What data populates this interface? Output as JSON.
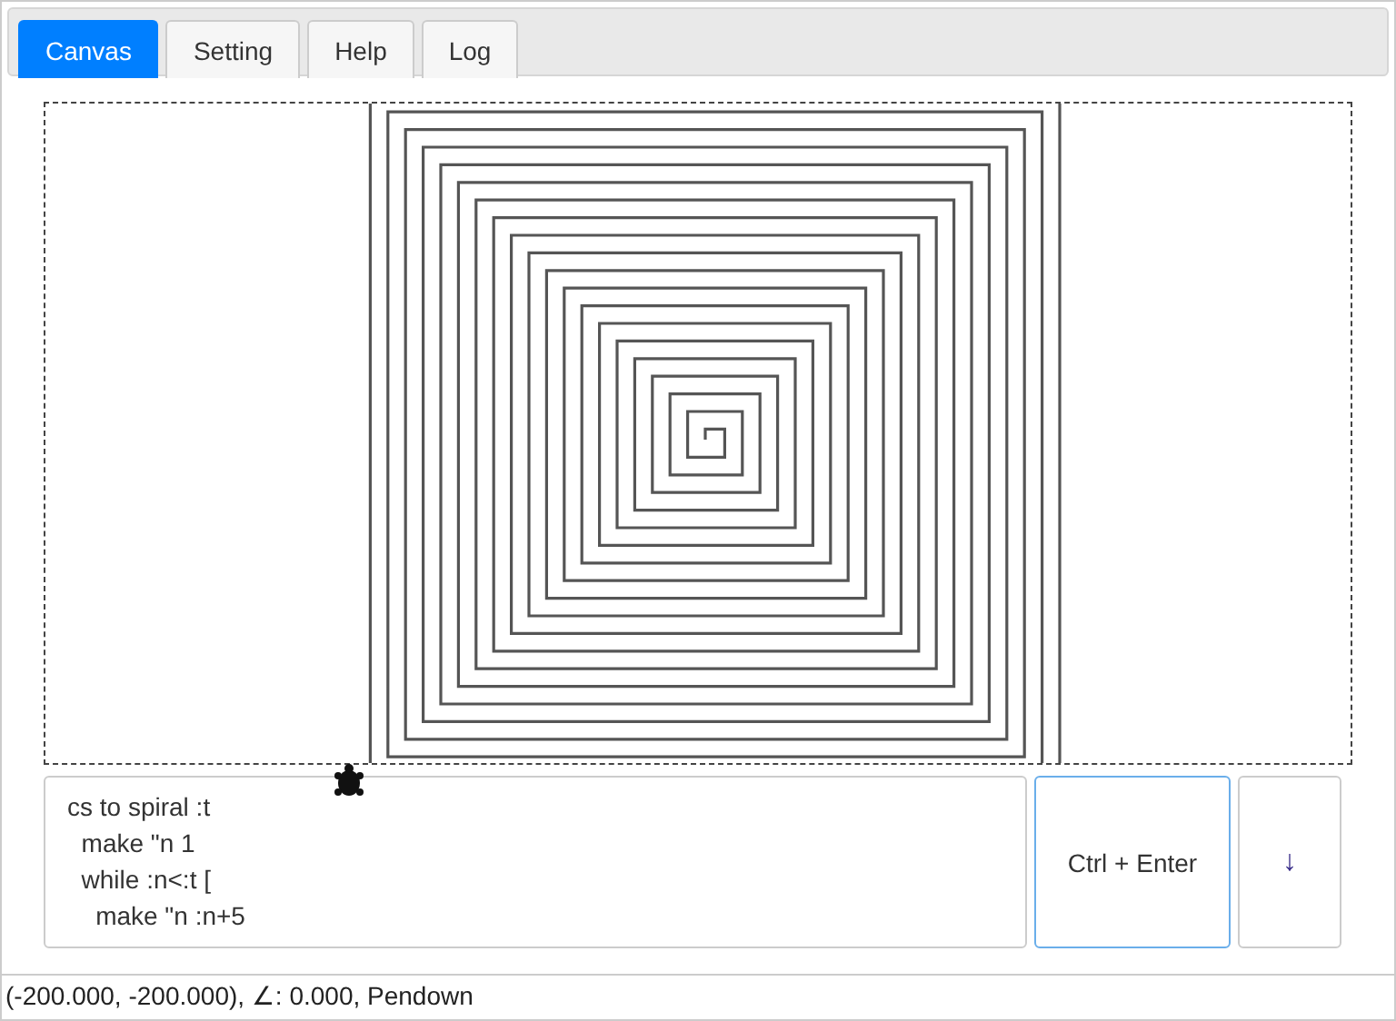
{
  "tabs": [
    {
      "label": "Canvas",
      "selected": true
    },
    {
      "label": "Setting",
      "selected": false
    },
    {
      "label": "Help",
      "selected": false
    },
    {
      "label": "Log",
      "selected": false
    }
  ],
  "editor": {
    "value": "cs to spiral :t\n  make \"n 1\n  while :n<:t [\n    make \"n :n+5"
  },
  "buttons": [
    {
      "label": "Ctrl + Enter",
      "kind": "run"
    },
    {
      "label": "↓",
      "kind": "arrow"
    }
  ],
  "status_bar": "(-200.000, -200.000), ∠: 0.000, Pendown"
}
